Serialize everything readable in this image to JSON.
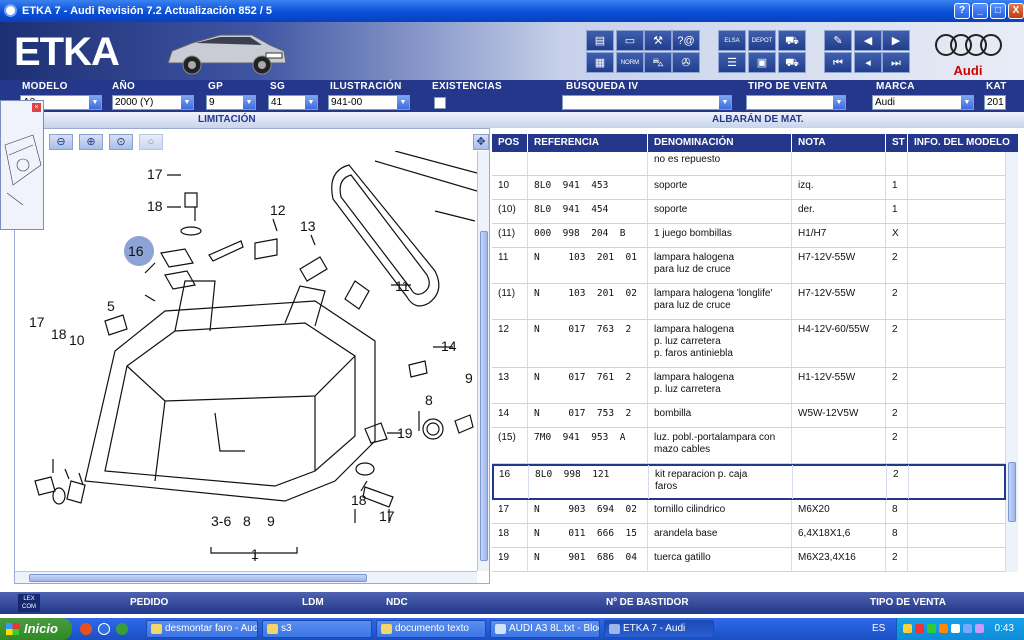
{
  "window": {
    "title": "ETKA 7 - Audi Revisión 7.2 Actualización 852 / 5",
    "buttons": [
      "?",
      "_",
      "□",
      "X"
    ]
  },
  "header": {
    "logo": "ETKA",
    "toolbar": {
      "badge_elsa": "ELSA",
      "badge_depot": "DEPOT",
      "badge_norm": "NORM",
      "info_glyph": "?@"
    },
    "brand_name": "Audi"
  },
  "fields": {
    "labels": {
      "modelo": "MODELO",
      "ano": "AÑO",
      "gp": "GP",
      "sg": "SG",
      "ilustracion": "ILUSTRACIÓN",
      "existencias": "EXISTENCIAS",
      "busqueda": "BÚSQUEDA IV",
      "tipo_venta": "TIPO DE VENTA",
      "marca": "MARCA",
      "kat": "KAT"
    },
    "values": {
      "modelo": "A3",
      "ano": "2000 (Y)",
      "gp": "9",
      "sg": "41",
      "ilustracion": "941-00",
      "busqueda": "",
      "tipo_venta": "",
      "marca": "Audi",
      "kat": "201"
    }
  },
  "sections": {
    "limitacion": "LIMITACIÓN",
    "albaran": "ALBARÁN DE MAT."
  },
  "zoom_buttons": [
    "zoom-out",
    "zoom-in",
    "zoom-fit",
    "zoom-reset"
  ],
  "diagram_labels": [
    "17",
    "18",
    "12",
    "13",
    "16",
    "5",
    "11",
    "17",
    "18",
    "10",
    "14",
    "9",
    "8",
    "19",
    "18",
    "17",
    "3-6",
    "8",
    "9",
    "1"
  ],
  "table": {
    "headers": [
      "POS",
      "REFERENCIA",
      "DENOMINACIÓN",
      "NOTA",
      "ST",
      "INFO. DEL MODELO"
    ],
    "rows": [
      {
        "pos": "",
        "ref": "",
        "den": [
          "no es repuesto"
        ],
        "nota": "",
        "st": "",
        "info": ""
      },
      {
        "pos": "10",
        "ref": "8L0  941  453",
        "den": [
          "soporte"
        ],
        "nota": "izq.",
        "st": "1",
        "info": ""
      },
      {
        "pos": "(10)",
        "ref": "8L0  941  454",
        "den": [
          "soporte"
        ],
        "nota": "der.",
        "st": "1",
        "info": ""
      },
      {
        "pos": "(11)",
        "ref": "000  998  204  B",
        "den": [
          "1 juego bombillas"
        ],
        "nota": "H1/H7",
        "st": "X",
        "info": ""
      },
      {
        "pos": "11",
        "ref": "N     103  201  01",
        "den": [
          "lampara halogena",
          "para luz de cruce"
        ],
        "nota": "H7-12V-55W",
        "st": "2",
        "info": ""
      },
      {
        "pos": "(11)",
        "ref": "N     103  201  02",
        "den": [
          "lampara halogena 'longlife'",
          "para luz de cruce"
        ],
        "nota": "H7-12V-55W",
        "st": "2",
        "info": ""
      },
      {
        "pos": "12",
        "ref": "N     017  763  2",
        "den": [
          "lampara halogena",
          "p. luz carretera",
          "p. faros antiniebla"
        ],
        "nota": "H4-12V-60/55W",
        "st": "2",
        "info": ""
      },
      {
        "pos": "13",
        "ref": "N     017  761  2",
        "den": [
          "lampara halogena",
          "p. luz carretera"
        ],
        "nota": "H1-12V-55W",
        "st": "2",
        "info": ""
      },
      {
        "pos": "14",
        "ref": "N     017  753  2",
        "den": [
          "bombilla"
        ],
        "nota": "W5W-12V5W",
        "st": "2",
        "info": ""
      },
      {
        "pos": "(15)",
        "ref": "7M0  941  953  A",
        "den": [
          "luz. pobl.-portalampara con",
          "mazo cables"
        ],
        "nota": "",
        "st": "2",
        "info": ""
      },
      {
        "pos": "16",
        "ref": "8L0  998  121",
        "den": [
          "kit reparacion p. caja",
          "faros"
        ],
        "nota": "",
        "st": "2",
        "info": "",
        "selected": true
      },
      {
        "pos": "17",
        "ref": "N     903  694  02",
        "den": [
          "tornillo cilindrico"
        ],
        "nota": "M6X20",
        "st": "8",
        "info": ""
      },
      {
        "pos": "18",
        "ref": "N     011  666  15",
        "den": [
          "arandela base"
        ],
        "nota": "6,4X18X1,6",
        "st": "8",
        "info": ""
      },
      {
        "pos": "19",
        "ref": "N     901  686  04",
        "den": [
          "tuerca gatillo"
        ],
        "nota": "M6X23,4X16",
        "st": "2",
        "info": ""
      }
    ]
  },
  "bottom_bar": {
    "lexcom": "LEX COM",
    "items": [
      "PEDIDO",
      "LDM",
      "NDC",
      "Nº DE BASTIDOR",
      "TIPO DE VENTA"
    ]
  },
  "taskbar": {
    "start": "Inicio",
    "tasks": [
      "desmontar faro - Aud...",
      "s3",
      "documento texto",
      "AUDI A3 8L.txt - Bloc...",
      "ETKA 7 - Audi"
    ],
    "language": "ES",
    "clock": "0:43"
  },
  "colors": {
    "navy": "#24378a",
    "titlebar": "#0a4fd6",
    "audi_red": "#cc0000"
  }
}
